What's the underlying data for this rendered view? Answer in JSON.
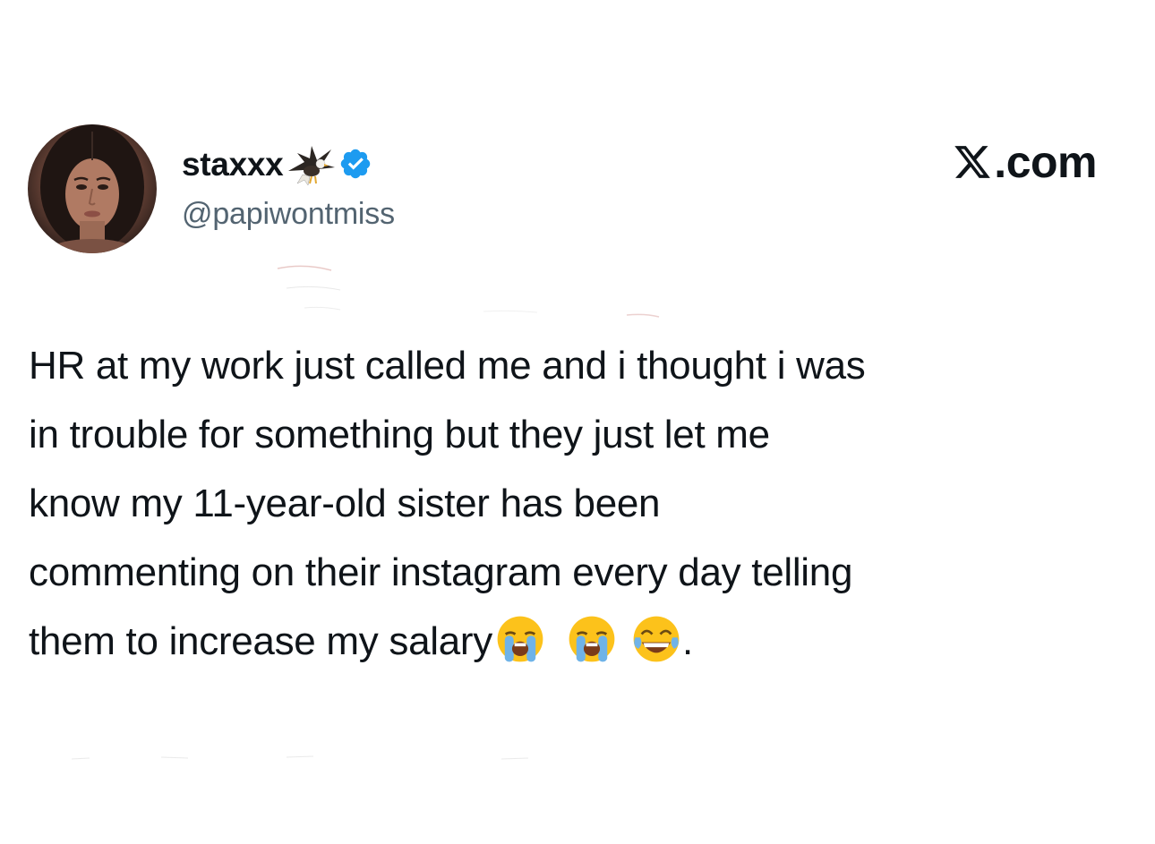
{
  "tweet": {
    "display_name": "staxxx",
    "name_emoji_icon": "eagle-icon",
    "verified_icon": "verified-badge-icon",
    "handle": "@papiwontmiss",
    "text_lines": [
      "HR at my work just called me and i thought i was",
      "in trouble for something but they just let me",
      "know my 11-year-old sister has been",
      "commenting on their instagram every day telling",
      "them to increase my salary"
    ],
    "trailing_emojis": [
      "loudly-crying-face-icon",
      "loudly-crying-face-icon",
      "face-with-tears-of-joy-icon"
    ],
    "trailing_punctuation": "."
  },
  "site": {
    "label": ".com",
    "logo_icon": "x-logo-icon"
  },
  "colors": {
    "text": "#0f1419",
    "handle": "#536471",
    "verified": "#1d9bf0",
    "background": "#ffffff"
  }
}
